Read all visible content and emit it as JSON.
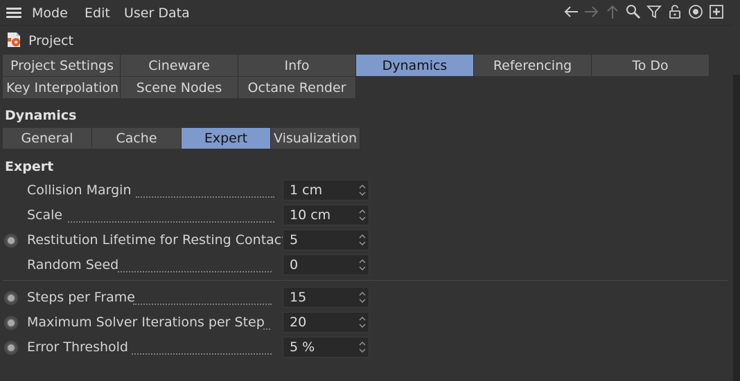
{
  "menubar": {
    "items": [
      "Mode",
      "Edit",
      "User Data"
    ],
    "icons": [
      "back-arrow-icon",
      "forward-arrow-icon",
      "up-arrow-icon",
      "search-icon",
      "filter-icon",
      "lock-icon",
      "target-icon",
      "new-panel-icon"
    ]
  },
  "header": {
    "title": "Project",
    "icon": "project-icon"
  },
  "main_tabs": {
    "row1": [
      "Project Settings",
      "Cineware",
      "Info",
      "Dynamics",
      "Referencing",
      "To Do"
    ],
    "row2": [
      "Key Interpolation",
      "Scene Nodes",
      "Octane Render"
    ],
    "active": "Dynamics"
  },
  "section": {
    "title": "Dynamics"
  },
  "sub_tabs": {
    "items": [
      "General",
      "Cache",
      "Expert",
      "Visualization"
    ],
    "active": "Expert"
  },
  "group": {
    "title": "Expert"
  },
  "params": [
    {
      "label": "Collision Margin",
      "value": "1 cm",
      "radio": false
    },
    {
      "label": "Scale",
      "value": "10 cm",
      "radio": false
    },
    {
      "label": "Restitution Lifetime for Resting Contact",
      "value": "5",
      "radio": true
    },
    {
      "label": "Random Seed",
      "value": "0",
      "radio": false
    },
    {
      "label": "Steps per Frame",
      "value": "15",
      "radio": true
    },
    {
      "label": "Maximum Solver Iterations per Step",
      "value": "20",
      "radio": true
    },
    {
      "label": "Error Threshold",
      "value": "5 %",
      "radio": true
    }
  ],
  "colors": {
    "background": "#333333",
    "active_tab": "#7e9acd",
    "tab": "#464646",
    "field": "#292929"
  }
}
